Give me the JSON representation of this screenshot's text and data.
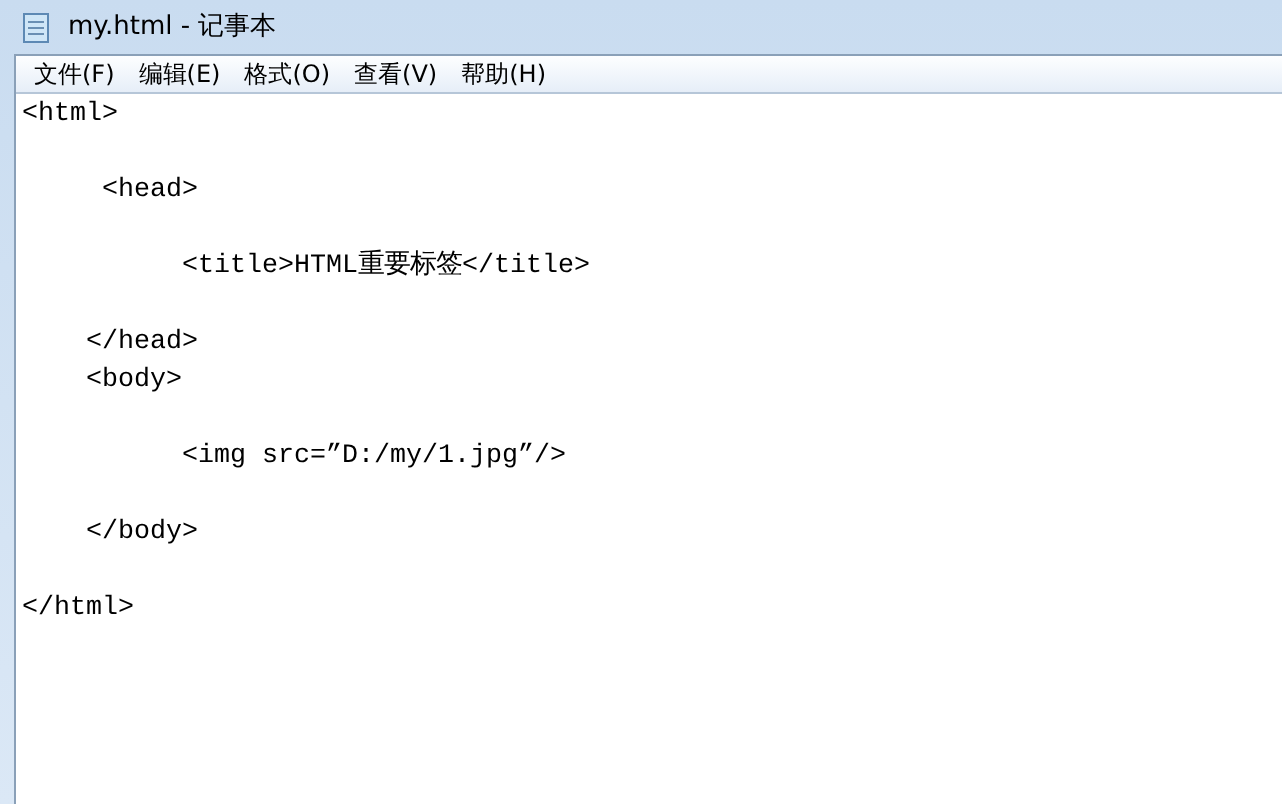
{
  "window": {
    "title": "my.html - 记事本"
  },
  "menu": [
    "文件(F)",
    "编辑(E)",
    "格式(O)",
    "查看(V)",
    "帮助(H)"
  ],
  "editor": {
    "text": "<html>\n\n     <head>\n\n          <title>HTML重要标签</title>\n\n    </head>\n    <body>\n\n          <img src=”D:/my/1.jpg”/>\n\n    </body>\n\n</html>"
  }
}
